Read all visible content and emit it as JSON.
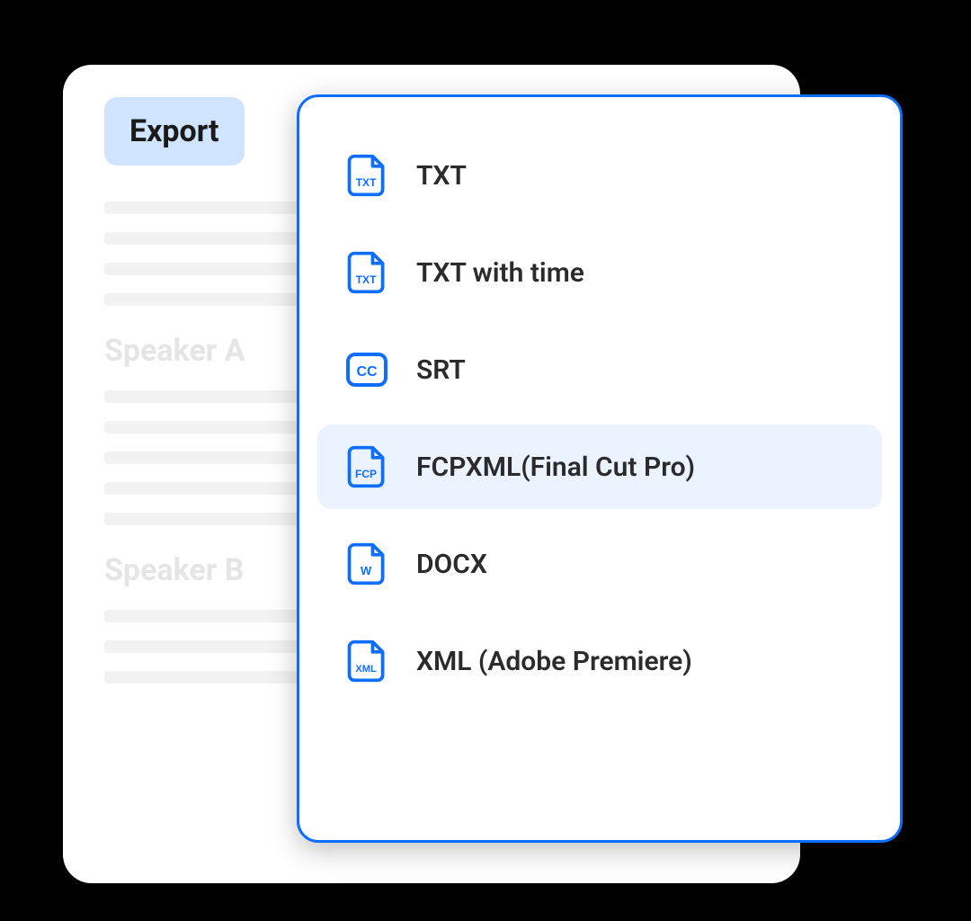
{
  "export_button_label": "Export",
  "background": {
    "speaker_a": "Speaker A",
    "speaker_b": "Speaker B"
  },
  "menu": {
    "items": [
      {
        "label": "TXT",
        "icon": "txt-file-icon",
        "highlighted": false
      },
      {
        "label": "TXT with time",
        "icon": "txt-file-icon",
        "highlighted": false
      },
      {
        "label": "SRT",
        "icon": "cc-icon",
        "highlighted": false
      },
      {
        "label": "FCPXML(Final Cut Pro)",
        "icon": "fcp-file-icon",
        "highlighted": true
      },
      {
        "label": "DOCX",
        "icon": "word-file-icon",
        "highlighted": false
      },
      {
        "label": "XML (Adobe Premiere)",
        "icon": "xml-file-icon",
        "highlighted": false
      }
    ]
  },
  "colors": {
    "accent": "#0d6efd",
    "highlight_bg": "#eaf3ff",
    "button_bg": "#d1e4ff"
  }
}
